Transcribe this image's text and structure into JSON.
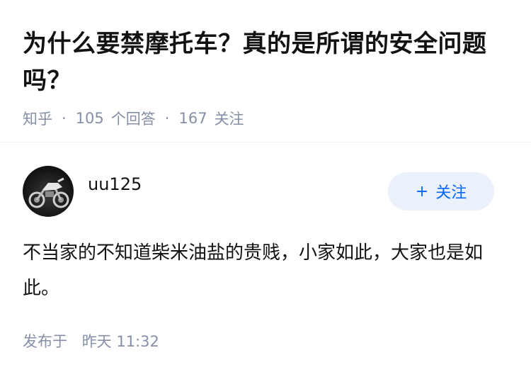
{
  "question": {
    "title": "为什么要禁摩托车？真的是所谓的安全问题吗？",
    "source": "知乎",
    "answer_count": "105",
    "answer_count_label": "个回答",
    "follower_count": "167",
    "follower_label": "关注"
  },
  "answer": {
    "author": {
      "name": "uu125",
      "avatar_icon": "motorcycle-avatar"
    },
    "follow_button": {
      "icon": "plus-icon",
      "label": "关注"
    },
    "content": "不当家的不知道柴米油盐的贵贱，小家如此，大家也是如此。",
    "published_label": "发布于",
    "published_time": "昨天 11:32"
  },
  "colors": {
    "accent": "#0066ff",
    "button_bg": "#ebf1fa",
    "meta_text": "#8590a6",
    "body_text": "#121212"
  }
}
